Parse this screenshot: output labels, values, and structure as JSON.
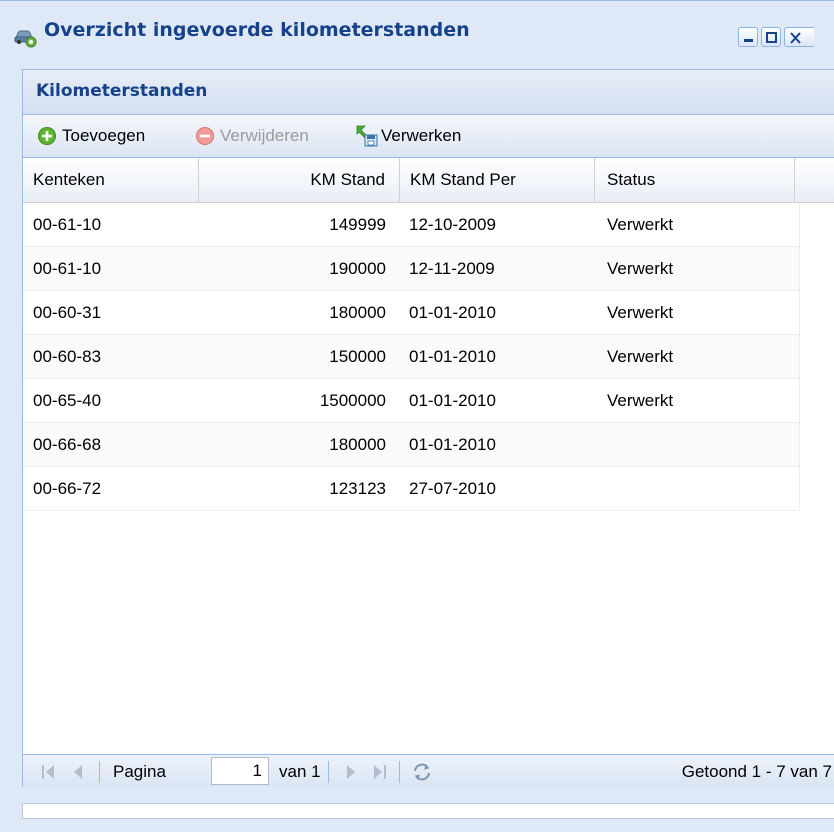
{
  "window": {
    "title": "Overzicht ingevoerde kilometerstanden",
    "icon": "car-gear-icon"
  },
  "panel": {
    "title": "Kilometerstanden"
  },
  "toolbar": {
    "add_label": "Toevoegen",
    "delete_label": "Verwijderen",
    "process_label": "Verwerken"
  },
  "grid": {
    "columns": [
      "Kenteken",
      "KM Stand",
      "KM Stand Per",
      "Status"
    ],
    "rows": [
      [
        "00-61-10",
        "149999",
        "12-10-2009",
        "Verwerkt"
      ],
      [
        "00-61-10",
        "190000",
        "12-11-2009",
        "Verwerkt"
      ],
      [
        "00-60-31",
        "180000",
        "01-01-2010",
        "Verwerkt"
      ],
      [
        "00-60-83",
        "150000",
        "01-01-2010",
        "Verwerkt"
      ],
      [
        "00-65-40",
        "1500000",
        "01-01-2010",
        "Verwerkt"
      ],
      [
        "00-66-68",
        "180000",
        "01-01-2010",
        ""
      ],
      [
        "00-66-72",
        "123123",
        "27-07-2010",
        ""
      ]
    ]
  },
  "pager": {
    "page_label": "Pagina",
    "page_value": "1",
    "of_label": "van 1",
    "display_info": "Getoond 1 - 7 van 7"
  },
  "colors": {
    "title_text": "#15428b",
    "border": "#99bbe8",
    "window_bg": "#dfe8f6"
  }
}
